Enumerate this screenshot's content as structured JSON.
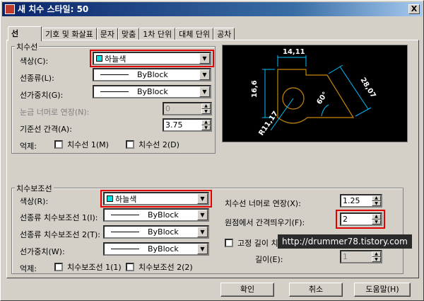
{
  "window": {
    "title": "새 치수 스타일: 50",
    "close_label": "X"
  },
  "tabs": [
    "선",
    "기호 및 화살표",
    "문자",
    "맞춤",
    "1차 단위",
    "대체 단위",
    "공차"
  ],
  "dim_lines": {
    "legend": "치수선",
    "color_label": "색상(C):",
    "color_value": "하늘색",
    "linetype_label": "선종류(L):",
    "linetype_value": "ByBlock",
    "lineweight_label": "선가중치(G):",
    "lineweight_value": "ByBlock",
    "extend_ticks_label": "눈금 너머로 연장(N):",
    "extend_ticks_value": "0",
    "baseline_label": "기준선 간격(A):",
    "baseline_value": "3.75",
    "suppress_label": "억제:",
    "suppress1_label": "치수선 1(M)",
    "suppress2_label": "치수선 2(D)"
  },
  "ext_lines": {
    "legend": "치수보조선",
    "color_label": "색상(R):",
    "color_value": "하늘색",
    "linetype1_label": "선종류 치수보조선 1(I):",
    "linetype1_value": "ByBlock",
    "linetype2_label": "선종류 치수보조선 2(T):",
    "linetype2_value": "ByBlock",
    "lineweight_label": "선가중치(W):",
    "lineweight_value": "ByBlock",
    "suppress_label": "억제:",
    "suppress1_label": "치수보조선 1(1)",
    "suppress2_label": "치수보조선 2(2)",
    "extend_label": "치수선 너머로 연장(X):",
    "extend_value": "1.25",
    "offset_label": "원점에서 간격띄우기(F):",
    "offset_value": "2",
    "fixed_label": "고정 길이 치",
    "length_label": "길이(E):",
    "length_value": "1"
  },
  "preview": {
    "dim_top": "14,11",
    "dim_left": "16,6",
    "dim_right": "28,07",
    "dim_angle": "60°",
    "dim_radius": "R11,17"
  },
  "buttons": {
    "ok": "확인",
    "cancel": "취소",
    "help": "도움말(H)"
  },
  "watermark": "http://drummer78.tistory.com",
  "colors": {
    "swatch": "#00e0e0",
    "highlight": "#e00000",
    "preview_lines": "#c8860a",
    "preview_dims": "#ffffff",
    "preview_dim_lines": "#00c0ff"
  }
}
